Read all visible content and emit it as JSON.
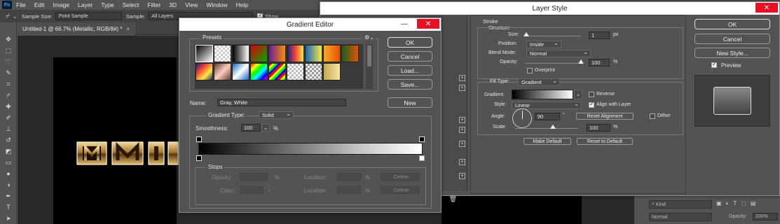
{
  "app": {
    "menu": [
      "File",
      "Edit",
      "Image",
      "Layer",
      "Type",
      "Select",
      "Filter",
      "3D",
      "View",
      "Window",
      "Help"
    ],
    "logo": "Ps"
  },
  "options_bar": {
    "sample_size_label": "Sample Size:",
    "sample_size_value": "Point Sample",
    "sample_label": "Sample:",
    "sample_value": "All Layers",
    "show_label": "Show"
  },
  "document": {
    "tab_title": "Untitled-1 @ 66.7% (Metallic, RGB/8#) *",
    "tab_close": "×"
  },
  "canvas": {
    "metal_text": "M"
  },
  "gradient_editor": {
    "title": "Gradient Editor",
    "presets_label": "Presets",
    "buttons": {
      "ok": "OK",
      "cancel": "Cancel",
      "load": "Load...",
      "save": "Save...",
      "new": "New"
    },
    "name_label": "Name:",
    "name_value": "Gray, White",
    "gradient_type_label": "Gradient Type:",
    "gradient_type_value": "Solid",
    "smoothness_label": "Smoothness:",
    "smoothness_value": "100",
    "smoothness_unit": "%",
    "stops": {
      "title": "Stops",
      "opacity_label": "Opacity:",
      "opacity_unit": "%",
      "location_label": "Location:",
      "location_unit": "%",
      "delete_label": "Delete",
      "color_label": "Color:"
    },
    "preset_swatches": [
      "linear-gradient(135deg,#000,#fff)",
      "repeating-conic-gradient(#ccc 0 25%,#fff 0 50%) 0 0/6px 6px",
      "linear-gradient(90deg,#000,#fff)",
      "linear-gradient(135deg,#d00,#0a0)",
      "linear-gradient(90deg,#6a1b9a,#ff8f00)",
      "linear-gradient(90deg,#1a237e,#f44336,#ffeb3b)",
      "linear-gradient(90deg,#1565c0,#ffeb3b)",
      "linear-gradient(90deg,#f9a825,#e65100)",
      "linear-gradient(90deg,#1b5e20,#e65100)",
      "linear-gradient(135deg,#1a237e,#f44336,#ffeb3b,#1a237e)",
      "linear-gradient(135deg,#5d4037,#ffccbc,#5d4037)",
      "linear-gradient(135deg,#1565c0,#ffffff,#1565c0)",
      "linear-gradient(135deg,#f00,#ff0,#0f0,#0ff,#00f,#f0f)",
      "repeating-linear-gradient(135deg,#f00 0 3px,#ff0 3px 6px,#0f0 6px 9px,#00f 9px 12px)",
      "repeating-conic-gradient(#bbb 0 25%,#fff 0 50%) 0 0/6px 6px",
      "repeating-conic-gradient(#999 0 25%,#eee 0 50%) 0 0/6px 6px",
      "linear-gradient(90deg,#c8a84b,#f5e6a8)"
    ]
  },
  "layer_style": {
    "title": "Layer Style",
    "buttons": {
      "ok": "OK",
      "cancel": "Cancel",
      "new_style": "New Style..."
    },
    "preview_label": "Preview",
    "stroke": {
      "section": "Stroke",
      "structure": "Structure",
      "size_label": "Size:",
      "size_value": "1",
      "size_unit": "px",
      "position_label": "Position:",
      "position_value": "Inside",
      "blend_mode_label": "Blend Mode:",
      "blend_mode_value": "Normal",
      "opacity_label": "Opacity:",
      "opacity_value": "100",
      "opacity_unit": "%",
      "overprint_label": "Overprint"
    },
    "fill": {
      "fill_type_label": "Fill Type:",
      "fill_type_value": "Gradient",
      "gradient_label": "Gradient:",
      "reverse_label": "Reverse",
      "style_label": "Style:",
      "style_value": "Linear",
      "align_label": "Align with Layer",
      "angle_label": "Angle:",
      "angle_value": "90",
      "angle_unit": "°",
      "reset_alignment": "Reset Alignment",
      "dither_label": "Dither",
      "scale_label": "Scale:",
      "scale_value": "100",
      "scale_unit": "%"
    },
    "make_default": "Make Default",
    "reset_default": "Reset to Default"
  },
  "layers_panel": {
    "kind_label": "Kind",
    "blend_value": "Normal",
    "opacity_label": "Opacity:",
    "opacity_value": "100%"
  },
  "colors": {
    "accent_close": "#e81123",
    "panel_bg": "#535353"
  }
}
